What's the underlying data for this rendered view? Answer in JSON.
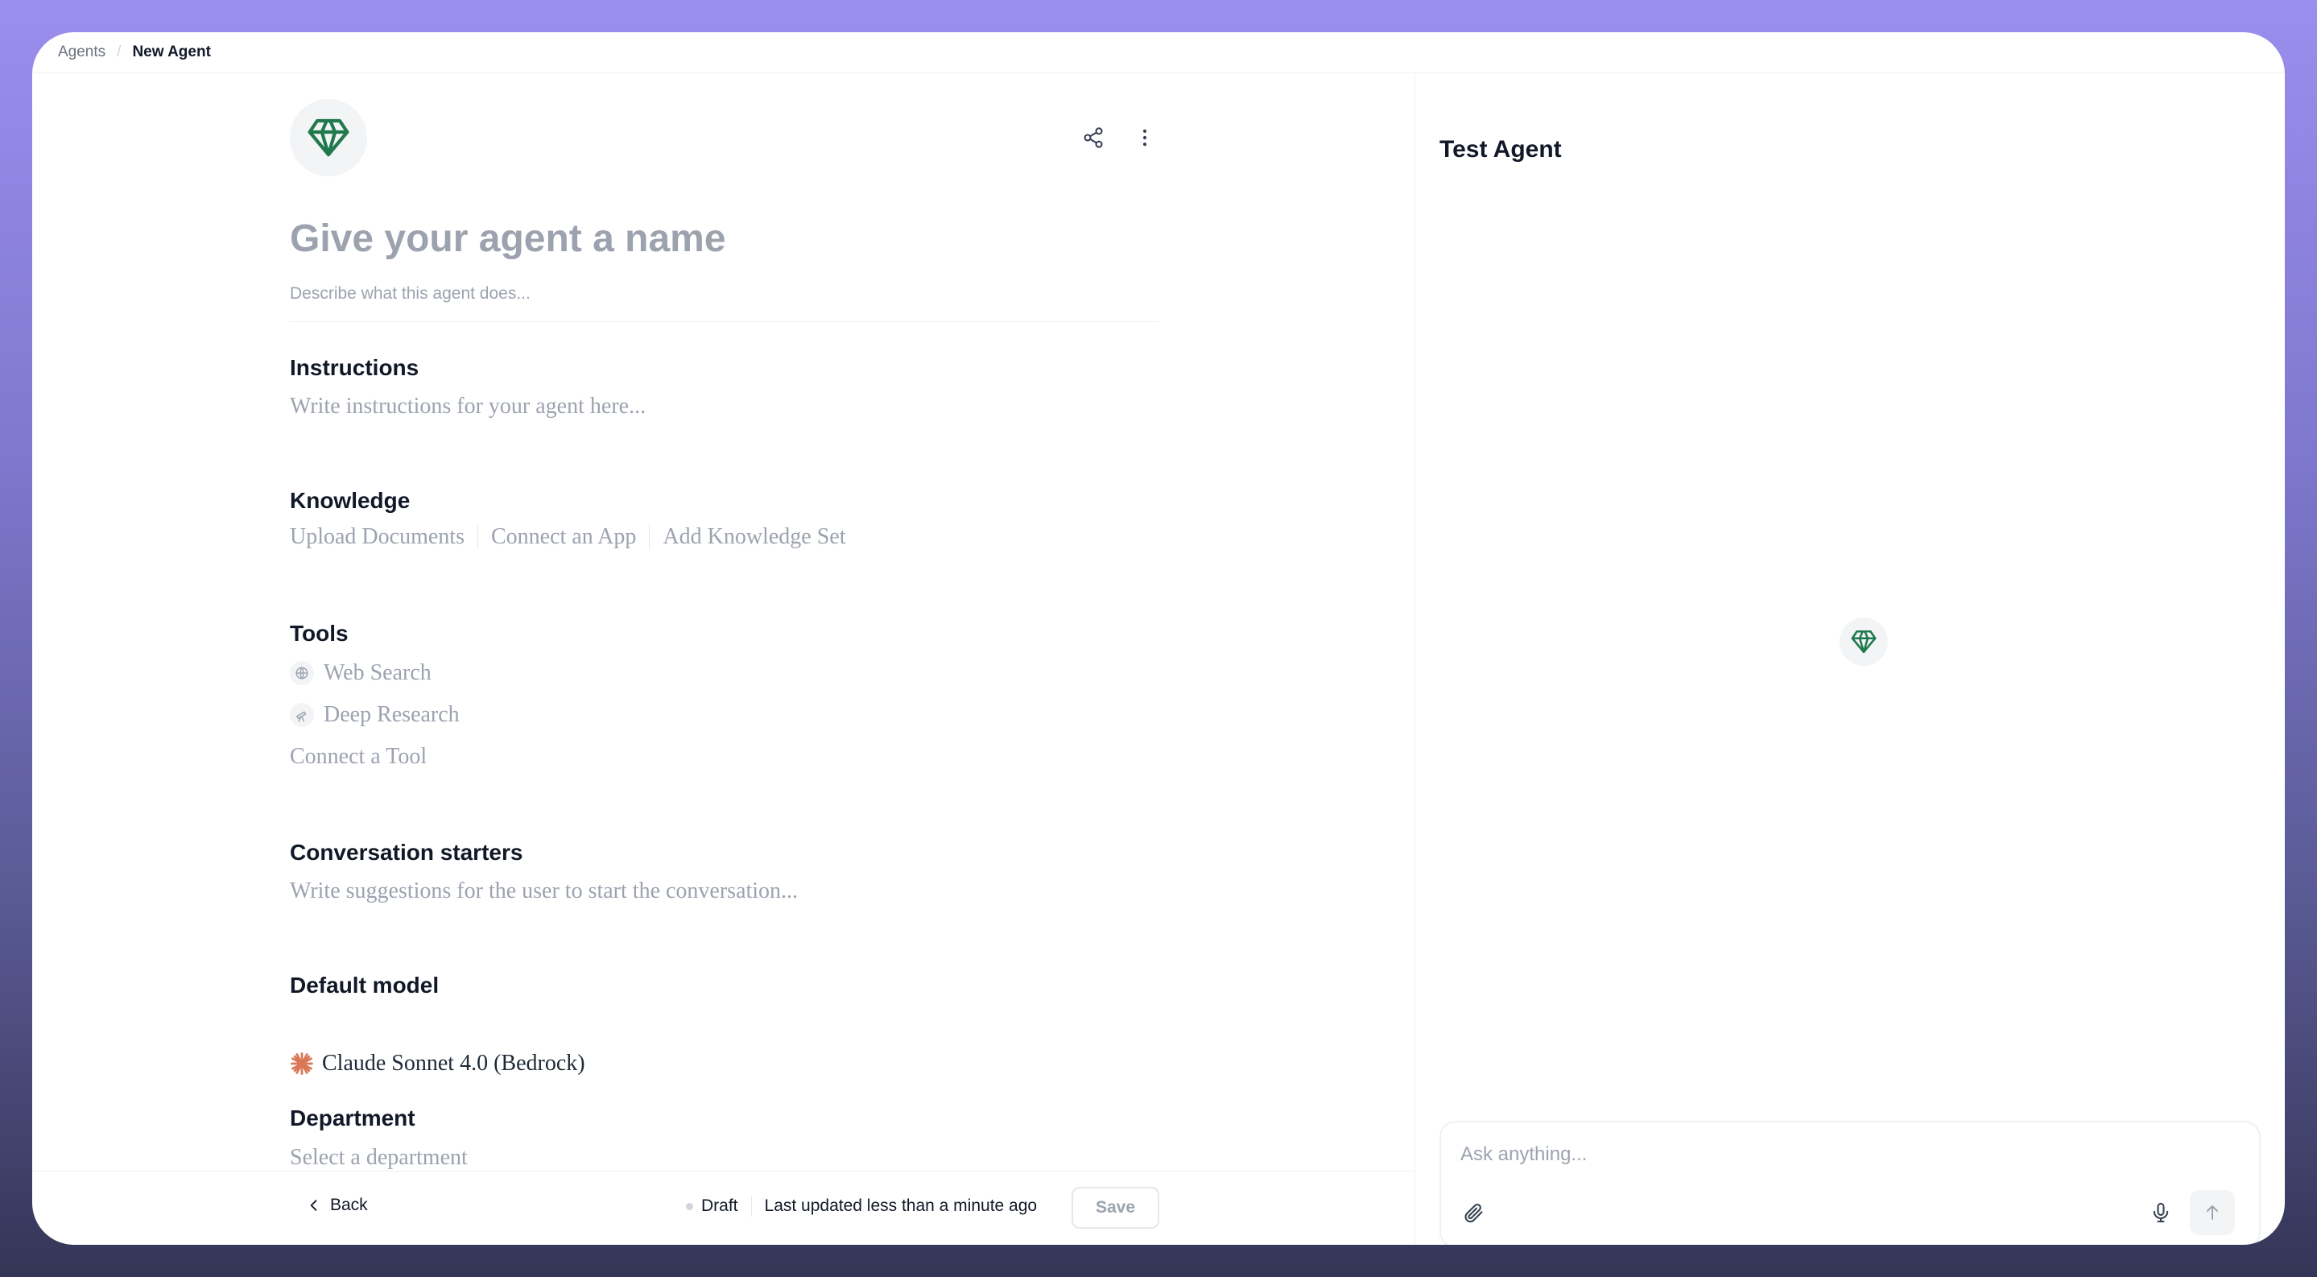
{
  "breadcrumb": {
    "root": "Agents",
    "separator": "/",
    "current": "New Agent"
  },
  "agent": {
    "avatar_icon": "gem-icon",
    "accent_color": "#1f7a4d",
    "name_placeholder": "Give your agent a name",
    "description_placeholder": "Describe what this agent does..."
  },
  "header_actions": {
    "share_icon": "share-icon",
    "more_icon": "more-vertical-icon"
  },
  "sections": {
    "instructions": {
      "title": "Instructions",
      "placeholder": "Write instructions for your agent here..."
    },
    "knowledge": {
      "title": "Knowledge",
      "actions": [
        "Upload Documents",
        "Connect an App",
        "Add Knowledge Set"
      ]
    },
    "tools": {
      "title": "Tools",
      "items": [
        {
          "label": "Web Search",
          "icon": "globe-icon"
        },
        {
          "label": "Deep Research",
          "icon": "telescope-icon"
        }
      ],
      "connect_label": "Connect a Tool"
    },
    "starters": {
      "title": "Conversation starters",
      "placeholder": "Write suggestions for the user to start the conversation..."
    },
    "model": {
      "title": "Default model",
      "value": "Claude Sonnet 4.0 (Bedrock)",
      "icon": "claude-icon",
      "icon_color": "#d97757"
    },
    "department": {
      "title": "Department",
      "placeholder": "Select a department"
    }
  },
  "footer": {
    "back_label": "Back",
    "status": "Draft",
    "updated": "Last updated less than a minute ago",
    "save_label": "Save"
  },
  "test_panel": {
    "title": "Test Agent",
    "input_placeholder": "Ask anything..."
  }
}
